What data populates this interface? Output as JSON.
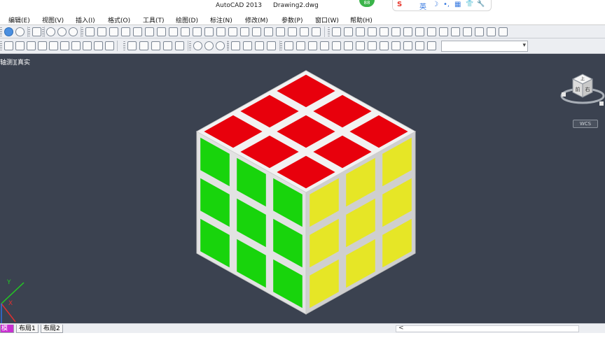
{
  "window": {
    "app_title": "AutoCAD 2013",
    "file_title": "Drawing2.dwg"
  },
  "ime": {
    "badge": "88",
    "logo": "S",
    "lang": "英",
    "moon": "☽",
    "dot": "•,",
    "keyboard": "▦",
    "shirt": "👕",
    "tool": "🔧"
  },
  "menu": {
    "items": [
      "编辑(E)",
      "视图(V)",
      "插入(I)",
      "格式(O)",
      "工具(T)",
      "绘图(D)",
      "标注(N)",
      "修改(M)",
      "参数(P)",
      "窗口(W)",
      "帮助(H)"
    ]
  },
  "viewport": {
    "label": "轴测][真实",
    "background": "#3b4250"
  },
  "cube": {
    "top_color": "#e8000c",
    "left_color": "#18d40c",
    "right_color": "#e6e626",
    "bevel_color": "#f2f2f2"
  },
  "viewcube": {
    "top_label": "上",
    "front_label": "前",
    "right_label": "右",
    "wcs_label": "WCS"
  },
  "ucs": {
    "x_label": "X",
    "y_label": "Y"
  },
  "layout_tabs": {
    "model": "模型",
    "layout1": "布局1",
    "layout2": "布局2"
  },
  "scroll": {
    "left_arrow": "<"
  }
}
